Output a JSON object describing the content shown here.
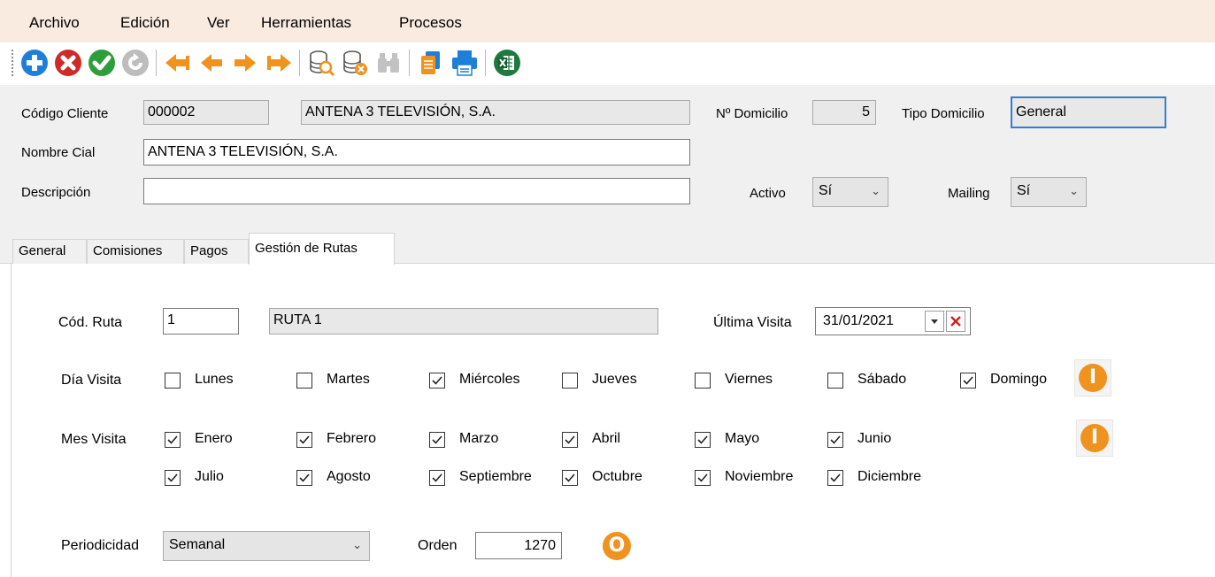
{
  "menu": [
    "Archivo",
    "Edición",
    "Ver",
    "Herramientas",
    "Procesos"
  ],
  "toolbar": {
    "icons": [
      "add-icon",
      "delete-icon",
      "confirm-icon",
      "refresh-icon",
      "first-icon",
      "previous-icon",
      "next-icon",
      "last-icon",
      "search-db-icon",
      "delete-db-icon",
      "binoculars-icon",
      "copy-icon",
      "print-icon",
      "excel-icon"
    ]
  },
  "header": {
    "codigo_cliente_label": "Código Cliente",
    "codigo_cliente": "000002",
    "cliente_nombre": "ANTENA 3 TELEVISIÓN, S.A.",
    "n_domicilio_label": "Nº Domicilio",
    "n_domicilio": "5",
    "tipo_domicilio_label": "Tipo Domicilio",
    "tipo_domicilio": "General",
    "nombre_cial_label": "Nombre Cial",
    "nombre_cial": "ANTENA 3 TELEVISIÓN, S.A.",
    "descripcion_label": "Descripción",
    "descripcion": "",
    "activo_label": "Activo",
    "activo": "Sí",
    "mailing_label": "Mailing",
    "mailing": "Sí"
  },
  "tabs": [
    "General",
    "Comisiones",
    "Pagos",
    "Gestión de Rutas"
  ],
  "active_tab": "Gestión de Rutas",
  "rutas": {
    "cod_ruta_label": "Cód. Ruta",
    "cod_ruta": "1",
    "ruta_nombre": "RUTA 1",
    "ultima_visita_label": "Última Visita",
    "ultima_visita": "31/01/2021",
    "dia_visita_label": "Día Visita",
    "dias": [
      {
        "label": "Lunes",
        "checked": false
      },
      {
        "label": "Martes",
        "checked": false
      },
      {
        "label": "Miércoles",
        "checked": true
      },
      {
        "label": "Jueves",
        "checked": false
      },
      {
        "label": "Viernes",
        "checked": false
      },
      {
        "label": "Sábado",
        "checked": false
      },
      {
        "label": "Domingo",
        "checked": true
      }
    ],
    "mes_visita_label": "Mes Visita",
    "meses": [
      {
        "label": "Enero",
        "checked": true
      },
      {
        "label": "Febrero",
        "checked": true
      },
      {
        "label": "Marzo",
        "checked": true
      },
      {
        "label": "Abril",
        "checked": true
      },
      {
        "label": "Mayo",
        "checked": true
      },
      {
        "label": "Junio",
        "checked": true
      },
      {
        "label": "Julio",
        "checked": true
      },
      {
        "label": "Agosto",
        "checked": true
      },
      {
        "label": "Septiembre",
        "checked": true
      },
      {
        "label": "Octubre",
        "checked": true
      },
      {
        "label": "Noviembre",
        "checked": true
      },
      {
        "label": "Diciembre",
        "checked": true
      }
    ],
    "periodicidad_label": "Periodicidad",
    "periodicidad": "Semanal",
    "orden_label": "Orden",
    "orden": "1270",
    "toggle_dias_glyph": "I",
    "toggle_meses_glyph": "I",
    "orden_glyph": "O"
  },
  "colors": {
    "accent_orange": "#f0921e",
    "menu_bg": "#f9ebe0",
    "panel_bg": "#f0f0f0"
  }
}
